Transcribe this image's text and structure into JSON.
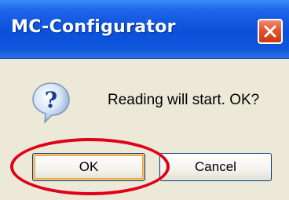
{
  "window": {
    "title": "MC-Configurator",
    "close_icon": "close-icon"
  },
  "dialog": {
    "icon": "question-icon",
    "message": "Reading will start. OK?"
  },
  "buttons": {
    "ok_label": "OK",
    "cancel_label": "Cancel"
  },
  "annotation": {
    "highlight_color": "#e00018",
    "highlight_target": "ok-button"
  },
  "colors": {
    "titlebar": "#0a50d9",
    "close_button": "#e4532d",
    "dialog_background": "#ece9d8"
  }
}
